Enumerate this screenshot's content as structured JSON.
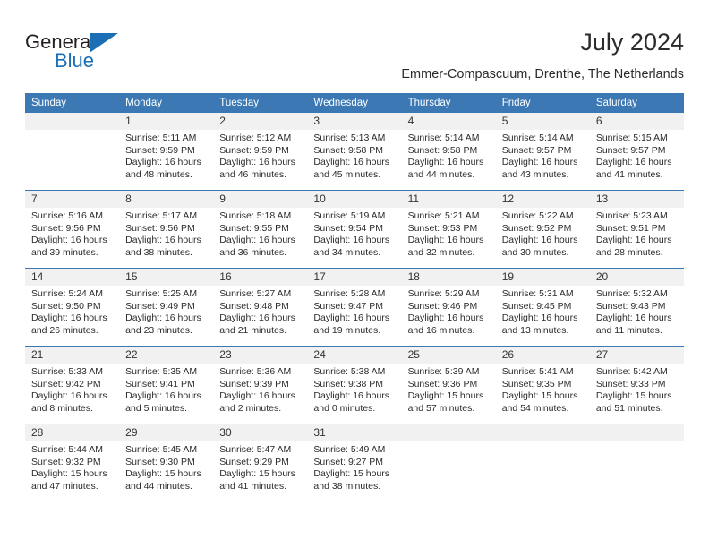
{
  "logo": {
    "primary_text": "General",
    "secondary_text": "Blue",
    "primary_color": "#231f20",
    "accent_color": "#1c6fb4"
  },
  "header": {
    "title": "July 2024",
    "subtitle": "Emmer-Compascuum, Drenthe, The Netherlands"
  },
  "theme": {
    "header_bg": "#3b78b4",
    "header_text": "#ffffff",
    "daynum_bg": "#f1f1f1",
    "rule_color": "#3b78b4",
    "body_text": "#2b2b2b"
  },
  "calendar": {
    "weekday_headers": [
      "Sunday",
      "Monday",
      "Tuesday",
      "Wednesday",
      "Thursday",
      "Friday",
      "Saturday"
    ],
    "labels": {
      "sunrise": "Sunrise:",
      "sunset": "Sunset:",
      "daylight": "Daylight:"
    },
    "weeks": [
      [
        {
          "day": "",
          "sunrise": "",
          "sunset": "",
          "daylight_1": "",
          "daylight_2": "",
          "blank": true
        },
        {
          "day": "1",
          "sunrise": "Sunrise: 5:11 AM",
          "sunset": "Sunset: 9:59 PM",
          "daylight_1": "Daylight: 16 hours",
          "daylight_2": "and 48 minutes."
        },
        {
          "day": "2",
          "sunrise": "Sunrise: 5:12 AM",
          "sunset": "Sunset: 9:59 PM",
          "daylight_1": "Daylight: 16 hours",
          "daylight_2": "and 46 minutes."
        },
        {
          "day": "3",
          "sunrise": "Sunrise: 5:13 AM",
          "sunset": "Sunset: 9:58 PM",
          "daylight_1": "Daylight: 16 hours",
          "daylight_2": "and 45 minutes."
        },
        {
          "day": "4",
          "sunrise": "Sunrise: 5:14 AM",
          "sunset": "Sunset: 9:58 PM",
          "daylight_1": "Daylight: 16 hours",
          "daylight_2": "and 44 minutes."
        },
        {
          "day": "5",
          "sunrise": "Sunrise: 5:14 AM",
          "sunset": "Sunset: 9:57 PM",
          "daylight_1": "Daylight: 16 hours",
          "daylight_2": "and 43 minutes."
        },
        {
          "day": "6",
          "sunrise": "Sunrise: 5:15 AM",
          "sunset": "Sunset: 9:57 PM",
          "daylight_1": "Daylight: 16 hours",
          "daylight_2": "and 41 minutes."
        }
      ],
      [
        {
          "day": "7",
          "sunrise": "Sunrise: 5:16 AM",
          "sunset": "Sunset: 9:56 PM",
          "daylight_1": "Daylight: 16 hours",
          "daylight_2": "and 39 minutes."
        },
        {
          "day": "8",
          "sunrise": "Sunrise: 5:17 AM",
          "sunset": "Sunset: 9:56 PM",
          "daylight_1": "Daylight: 16 hours",
          "daylight_2": "and 38 minutes."
        },
        {
          "day": "9",
          "sunrise": "Sunrise: 5:18 AM",
          "sunset": "Sunset: 9:55 PM",
          "daylight_1": "Daylight: 16 hours",
          "daylight_2": "and 36 minutes."
        },
        {
          "day": "10",
          "sunrise": "Sunrise: 5:19 AM",
          "sunset": "Sunset: 9:54 PM",
          "daylight_1": "Daylight: 16 hours",
          "daylight_2": "and 34 minutes."
        },
        {
          "day": "11",
          "sunrise": "Sunrise: 5:21 AM",
          "sunset": "Sunset: 9:53 PM",
          "daylight_1": "Daylight: 16 hours",
          "daylight_2": "and 32 minutes."
        },
        {
          "day": "12",
          "sunrise": "Sunrise: 5:22 AM",
          "sunset": "Sunset: 9:52 PM",
          "daylight_1": "Daylight: 16 hours",
          "daylight_2": "and 30 minutes."
        },
        {
          "day": "13",
          "sunrise": "Sunrise: 5:23 AM",
          "sunset": "Sunset: 9:51 PM",
          "daylight_1": "Daylight: 16 hours",
          "daylight_2": "and 28 minutes."
        }
      ],
      [
        {
          "day": "14",
          "sunrise": "Sunrise: 5:24 AM",
          "sunset": "Sunset: 9:50 PM",
          "daylight_1": "Daylight: 16 hours",
          "daylight_2": "and 26 minutes."
        },
        {
          "day": "15",
          "sunrise": "Sunrise: 5:25 AM",
          "sunset": "Sunset: 9:49 PM",
          "daylight_1": "Daylight: 16 hours",
          "daylight_2": "and 23 minutes."
        },
        {
          "day": "16",
          "sunrise": "Sunrise: 5:27 AM",
          "sunset": "Sunset: 9:48 PM",
          "daylight_1": "Daylight: 16 hours",
          "daylight_2": "and 21 minutes."
        },
        {
          "day": "17",
          "sunrise": "Sunrise: 5:28 AM",
          "sunset": "Sunset: 9:47 PM",
          "daylight_1": "Daylight: 16 hours",
          "daylight_2": "and 19 minutes."
        },
        {
          "day": "18",
          "sunrise": "Sunrise: 5:29 AM",
          "sunset": "Sunset: 9:46 PM",
          "daylight_1": "Daylight: 16 hours",
          "daylight_2": "and 16 minutes."
        },
        {
          "day": "19",
          "sunrise": "Sunrise: 5:31 AM",
          "sunset": "Sunset: 9:45 PM",
          "daylight_1": "Daylight: 16 hours",
          "daylight_2": "and 13 minutes."
        },
        {
          "day": "20",
          "sunrise": "Sunrise: 5:32 AM",
          "sunset": "Sunset: 9:43 PM",
          "daylight_1": "Daylight: 16 hours",
          "daylight_2": "and 11 minutes."
        }
      ],
      [
        {
          "day": "21",
          "sunrise": "Sunrise: 5:33 AM",
          "sunset": "Sunset: 9:42 PM",
          "daylight_1": "Daylight: 16 hours",
          "daylight_2": "and 8 minutes."
        },
        {
          "day": "22",
          "sunrise": "Sunrise: 5:35 AM",
          "sunset": "Sunset: 9:41 PM",
          "daylight_1": "Daylight: 16 hours",
          "daylight_2": "and 5 minutes."
        },
        {
          "day": "23",
          "sunrise": "Sunrise: 5:36 AM",
          "sunset": "Sunset: 9:39 PM",
          "daylight_1": "Daylight: 16 hours",
          "daylight_2": "and 2 minutes."
        },
        {
          "day": "24",
          "sunrise": "Sunrise: 5:38 AM",
          "sunset": "Sunset: 9:38 PM",
          "daylight_1": "Daylight: 16 hours",
          "daylight_2": "and 0 minutes."
        },
        {
          "day": "25",
          "sunrise": "Sunrise: 5:39 AM",
          "sunset": "Sunset: 9:36 PM",
          "daylight_1": "Daylight: 15 hours",
          "daylight_2": "and 57 minutes."
        },
        {
          "day": "26",
          "sunrise": "Sunrise: 5:41 AM",
          "sunset": "Sunset: 9:35 PM",
          "daylight_1": "Daylight: 15 hours",
          "daylight_2": "and 54 minutes."
        },
        {
          "day": "27",
          "sunrise": "Sunrise: 5:42 AM",
          "sunset": "Sunset: 9:33 PM",
          "daylight_1": "Daylight: 15 hours",
          "daylight_2": "and 51 minutes."
        }
      ],
      [
        {
          "day": "28",
          "sunrise": "Sunrise: 5:44 AM",
          "sunset": "Sunset: 9:32 PM",
          "daylight_1": "Daylight: 15 hours",
          "daylight_2": "and 47 minutes."
        },
        {
          "day": "29",
          "sunrise": "Sunrise: 5:45 AM",
          "sunset": "Sunset: 9:30 PM",
          "daylight_1": "Daylight: 15 hours",
          "daylight_2": "and 44 minutes."
        },
        {
          "day": "30",
          "sunrise": "Sunrise: 5:47 AM",
          "sunset": "Sunset: 9:29 PM",
          "daylight_1": "Daylight: 15 hours",
          "daylight_2": "and 41 minutes."
        },
        {
          "day": "31",
          "sunrise": "Sunrise: 5:49 AM",
          "sunset": "Sunset: 9:27 PM",
          "daylight_1": "Daylight: 15 hours",
          "daylight_2": "and 38 minutes."
        },
        {
          "day": "",
          "sunrise": "",
          "sunset": "",
          "daylight_1": "",
          "daylight_2": "",
          "blank": true
        },
        {
          "day": "",
          "sunrise": "",
          "sunset": "",
          "daylight_1": "",
          "daylight_2": "",
          "blank": true
        },
        {
          "day": "",
          "sunrise": "",
          "sunset": "",
          "daylight_1": "",
          "daylight_2": "",
          "blank": true
        }
      ]
    ]
  }
}
